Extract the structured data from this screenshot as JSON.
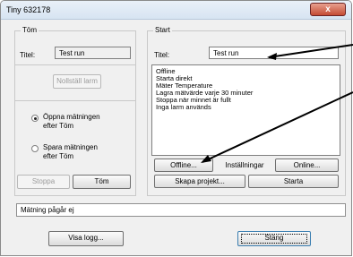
{
  "window": {
    "title": "Tiny 632178",
    "close_glyph": "x"
  },
  "tom": {
    "legend": "Töm",
    "title_label": "Titel:",
    "title_value": "Test run",
    "reset_alarm_label": "Nollställ larm",
    "radio_open": "Öppna mätningen efter Töm",
    "radio_save": "Spara mätningen efter Töm",
    "stop_label": "Stoppa",
    "empty_label": "Töm"
  },
  "start": {
    "legend": "Start",
    "title_label": "Titel:",
    "title_value": "Test run",
    "info_lines": [
      "Offline",
      "Starta direkt",
      "Mäter Temperature",
      "Lagra mätvärde varje 30 minuter",
      "Stoppa när minnet är fullt",
      "Inga larm används"
    ],
    "offline_label": "Offline...",
    "settings_label": "Inställningar",
    "online_label": "Online...",
    "create_project_label": "Skapa projekt...",
    "start_label": "Starta"
  },
  "status_text": "Mätning pågår ej",
  "show_log_label": "Visa logg...",
  "close_label": "Stäng"
}
